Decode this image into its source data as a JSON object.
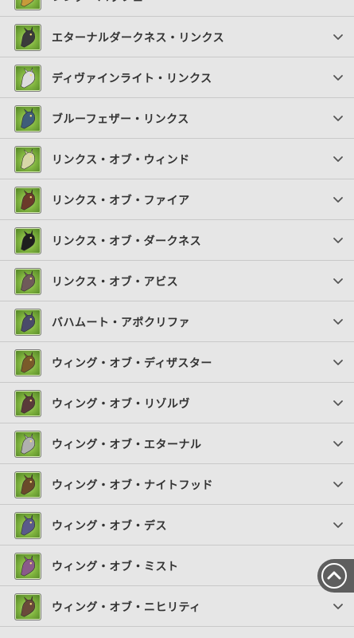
{
  "list": {
    "items": [
      {
        "label": "レンダーパッフェ",
        "icon": "render-buff-action-icon",
        "tint": "#c79b3a"
      },
      {
        "label": "エターナルダークネス・リンクス",
        "icon": "eternal-darkness-lynx-icon",
        "tint": "#3b3b3b"
      },
      {
        "label": "ディヴァインライト・リンクス",
        "icon": "divine-light-lynx-icon",
        "tint": "#dcdcdc"
      },
      {
        "label": "ブルーフェザー・リンクス",
        "icon": "blue-feather-lynx-icon",
        "tint": "#3f5d7a"
      },
      {
        "label": "リンクス・オブ・ウィンド",
        "icon": "lynx-of-wind-icon",
        "tint": "#d7d7a8"
      },
      {
        "label": "リンクス・オブ・ファイア",
        "icon": "lynx-of-fire-icon",
        "tint": "#6b3b2a"
      },
      {
        "label": "リンクス・オブ・ダークネス",
        "icon": "lynx-of-darkness-icon",
        "tint": "#1e1e1e"
      },
      {
        "label": "リンクス・オブ・アビス",
        "icon": "lynx-of-abyss-icon",
        "tint": "#6f5a5a"
      },
      {
        "label": "バハムート・アポクリファ",
        "icon": "bahamut-apocrypha-icon",
        "tint": "#4a4a6a"
      },
      {
        "label": "ウィング・オブ・ディザスター",
        "icon": "wing-of-disaster-icon",
        "tint": "#7a5a2a"
      },
      {
        "label": "ウィング・オブ・リゾルヴ",
        "icon": "wing-of-resolve-icon",
        "tint": "#5a3a3a"
      },
      {
        "label": "ウィング・オブ・エターナル",
        "icon": "wing-of-eternal-icon",
        "tint": "#b0b0b0"
      },
      {
        "label": "ウィング・オブ・ナイトフッド",
        "icon": "wing-of-knighthood-icon",
        "tint": "#6a4a2a"
      },
      {
        "label": "ウィング・オブ・デス",
        "icon": "wing-of-death-icon",
        "tint": "#5a5a8a"
      },
      {
        "label": "ウィング・オブ・ミスト",
        "icon": "wing-of-mist-icon",
        "tint": "#8a5a8a"
      },
      {
        "label": "ウィング・オブ・ニヒリティ",
        "icon": "wing-of-nihility-icon",
        "tint": "#6a4a3a"
      }
    ]
  },
  "scroll_top": {
    "icon": "scroll-to-top-icon"
  },
  "colors": {
    "background": "#e6e6e6",
    "divider": "#c9c9c9",
    "text": "#333333",
    "chevron": "#555555",
    "scroll_button": "#5e5e5e"
  }
}
